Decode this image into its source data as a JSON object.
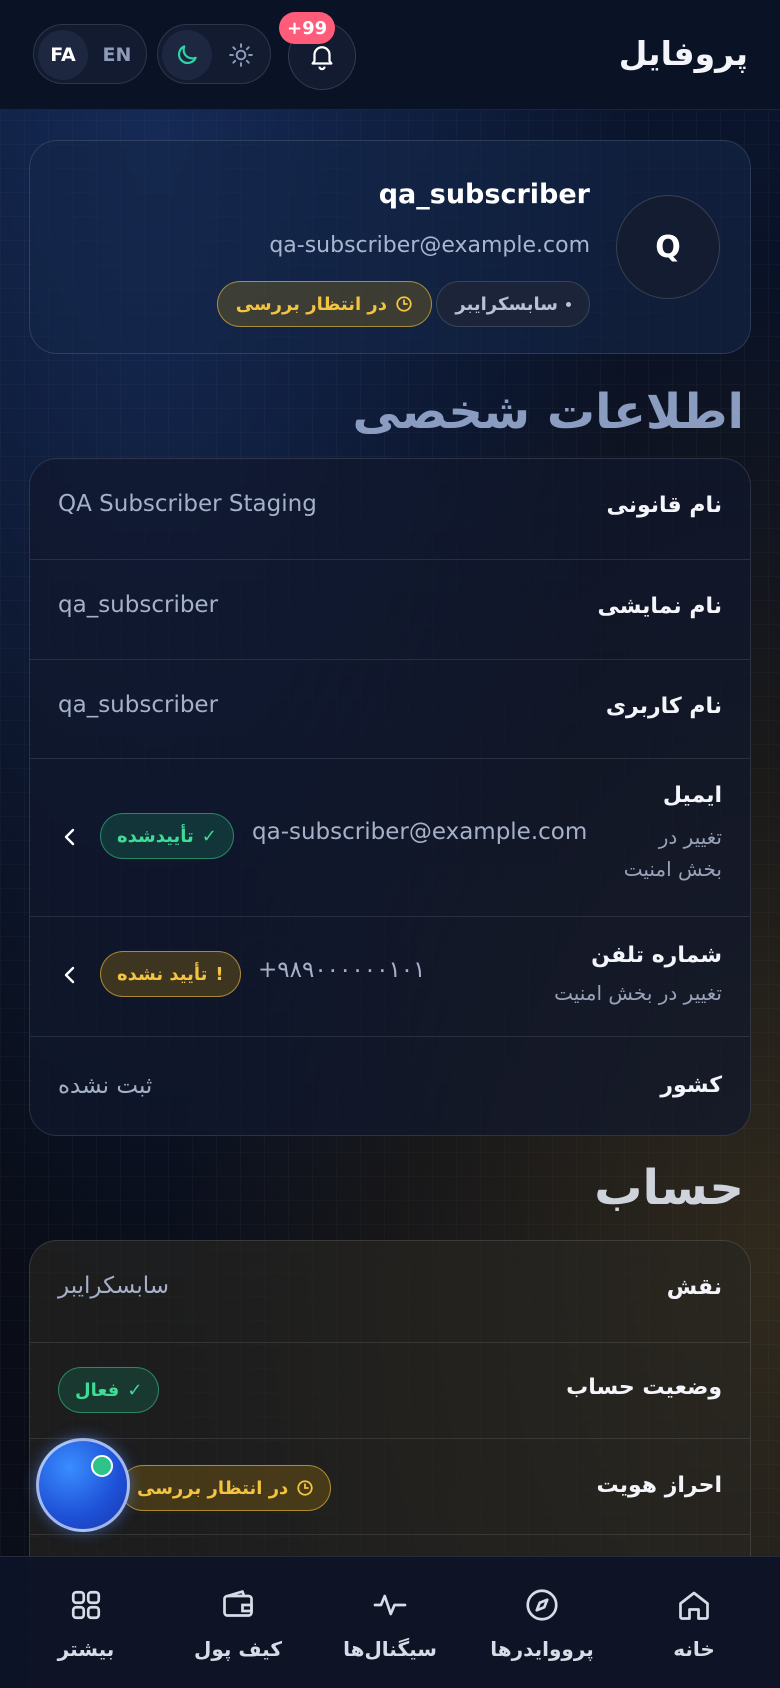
{
  "header": {
    "title": "پروفایل",
    "notifications_count": "+99",
    "lang_active": "FA",
    "lang_other": "EN"
  },
  "profile": {
    "avatar_letter": "Q",
    "username": "qa_subscriber",
    "email": "qa-subscriber@example.com",
    "role_chip": "سابسکرایبر",
    "status_chip": "در انتظار بررسی"
  },
  "personal": {
    "title": "اطلاعات شخصی",
    "rows": [
      {
        "label": "نام قانونی",
        "value": "QA Subscriber Staging"
      },
      {
        "label": "نام نمایشی",
        "value": "qa_subscriber"
      },
      {
        "label": "نام کاربری",
        "value": "qa_subscriber"
      }
    ],
    "email_row": {
      "label": "ایمیل",
      "sub_line1": "تغییر در",
      "sub_line2": "بخش امنیت",
      "value": "qa-subscriber@example.com",
      "chip": "تأییدشده",
      "chip_icon": "✓"
    },
    "phone_row": {
      "label": "شماره تلفن",
      "sub": "تغییر در بخش امنیت",
      "value": "+۹۸۹۰۰۰۰۰۰۱۰۱",
      "chip": "تأیید نشده",
      "chip_icon": "!"
    },
    "country_row": {
      "label": "کشور",
      "value": "ثبت نشده"
    }
  },
  "account": {
    "title": "حساب",
    "role_row": {
      "label": "نقش",
      "value": "سابسکرایبر"
    },
    "status_row": {
      "label": "وضعیت حساب",
      "chip": "فعال",
      "chip_icon": "✓"
    },
    "kyc_row": {
      "label": "احراز هویت",
      "chip": "در انتظار بررسی"
    }
  },
  "nav": {
    "home": "خانه",
    "providers": "پرووایدرها",
    "signals": "سیگنال‌ها",
    "wallet": "کیف پول",
    "more": "بیشتر"
  },
  "colors": {
    "accent_green": "#3ddc97",
    "accent_yellow": "#f4c33f",
    "badge_red": "#ff5c7a"
  }
}
